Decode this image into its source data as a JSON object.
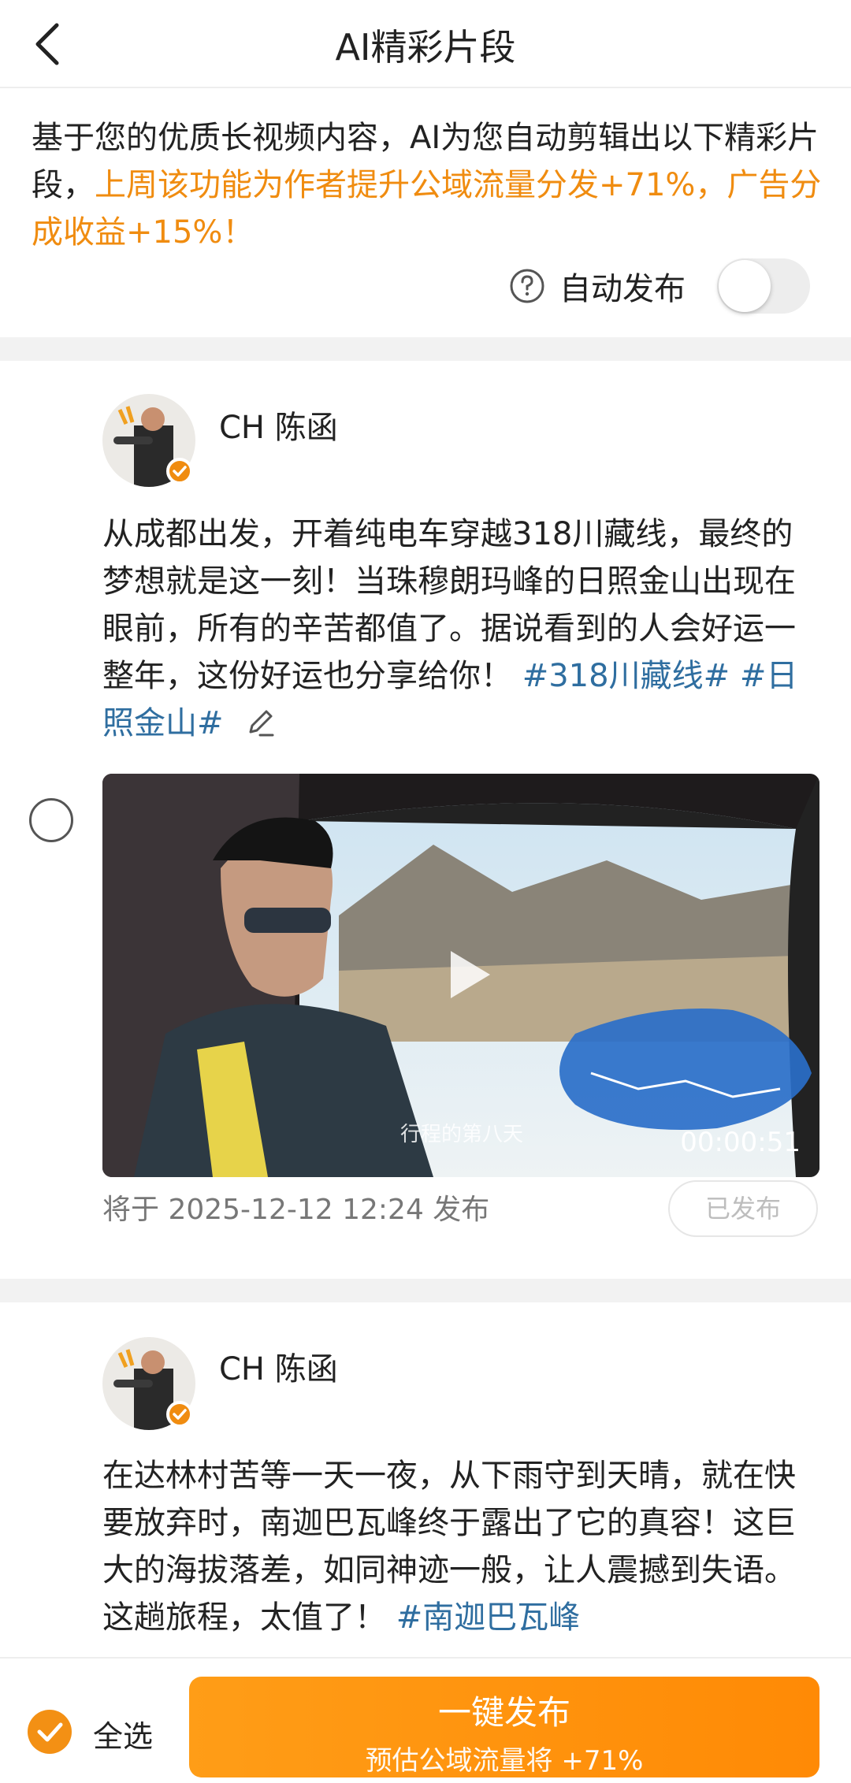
{
  "header": {
    "title": "AI精彩片段"
  },
  "intro": {
    "text_plain": "基于您的优质长视频内容，AI为您自动剪辑出以下精彩片段，",
    "text_highlight": "上周该功能为作者提升公域流量分发+71%，广告分成收益+15%！"
  },
  "auto_publish": {
    "label": "自动发布",
    "enabled": false
  },
  "posts": [
    {
      "author": "CH 陈函",
      "text": "从成都出发，开着纯电车穿越318川藏线，最终的梦想就是这一刻！当珠穆朗玛峰的日照金山出现在眼前，所有的辛苦都值了。据说看到的人会好运一整年，这份好运也分享给你！",
      "tags": [
        "#318川藏线#",
        "#日照金山#"
      ],
      "video": {
        "duration": "00:00:51",
        "caption": "行程的第八天"
      },
      "schedule": "将于 2025-12-12 12:24 发布",
      "status_button": "已发布"
    },
    {
      "author": "CH 陈函",
      "text": "在达林村苦等一天一夜，从下雨守到天晴，就在快要放弃时，南迦巴瓦峰终于露出了它的真容！这巨大的海拔落差，如同神迹一般，让人震撼到失语。这趟旅程，太值了！",
      "tags": [
        "#南迦巴瓦峰"
      ]
    }
  ],
  "bottom": {
    "select_all": "全选",
    "publish_button": "一键发布",
    "publish_sub": "预估公域流量将 +71%"
  },
  "colors": {
    "accent": "#f08c10",
    "tag": "#2f6ea0",
    "button_gradient_start": "#ff9d17",
    "button_gradient_end": "#ff8a05"
  }
}
